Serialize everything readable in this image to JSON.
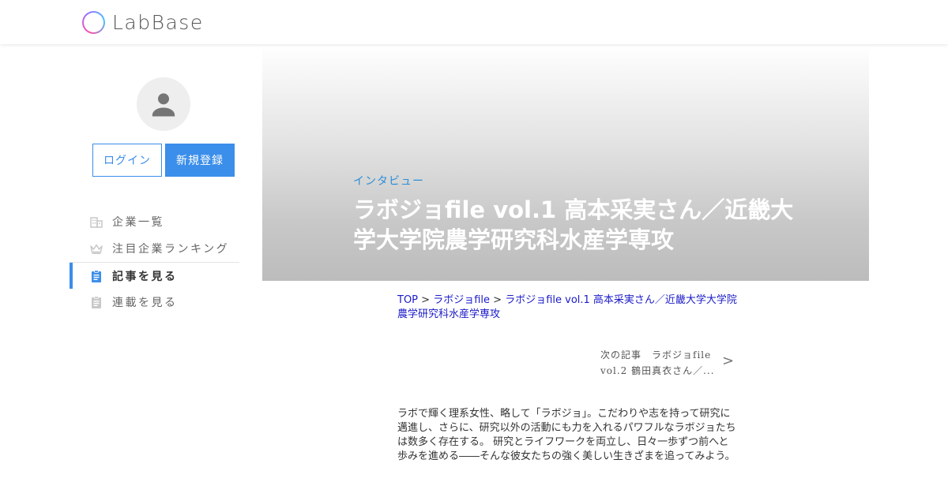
{
  "header": {
    "logo_text": "LabBase"
  },
  "sidebar": {
    "login_label": "ログイン",
    "register_label": "新規登録",
    "nav": [
      {
        "label": "企業一覧",
        "icon": "building-icon"
      },
      {
        "label": "注目企業ランキング",
        "icon": "crown-icon"
      },
      {
        "label": "記事を見る",
        "icon": "clipboard-icon",
        "active": true
      },
      {
        "label": "連載を見る",
        "icon": "clipboard-icon"
      }
    ]
  },
  "hero": {
    "category": "インタビュー",
    "title": "ラボジョfile vol.1 高本采実さん／近畿大学大学院農学研究科水産学専攻"
  },
  "breadcrumb": {
    "top": "TOP",
    "separator": ">",
    "series": "ラボジョfile",
    "current": "ラボジョfile vol.1 高本采実さん／近畿大学大学院農学研究科水産学専攻"
  },
  "next_article": {
    "line1": "次の記事　ラボジョfile",
    "line2": "vol.2 鶴田真衣さん／...",
    "arrow": ">"
  },
  "intro_text": "ラボで輝く理系女性、略して「ラボジョ」。こだわりや志を持って研究に邁進し、さらに、研究以外の活動にも力を入れるパワフルなラボジョたちは数多く存在する。 研究とライフワークを両立し、日々一歩ずつ前へと歩みを進める――そんな彼女たちの強く美しい生きざまを追ってみよう。",
  "colors": {
    "accent": "#3b8eea",
    "category": "#2c8ed8",
    "link": "#1a1ac8"
  }
}
